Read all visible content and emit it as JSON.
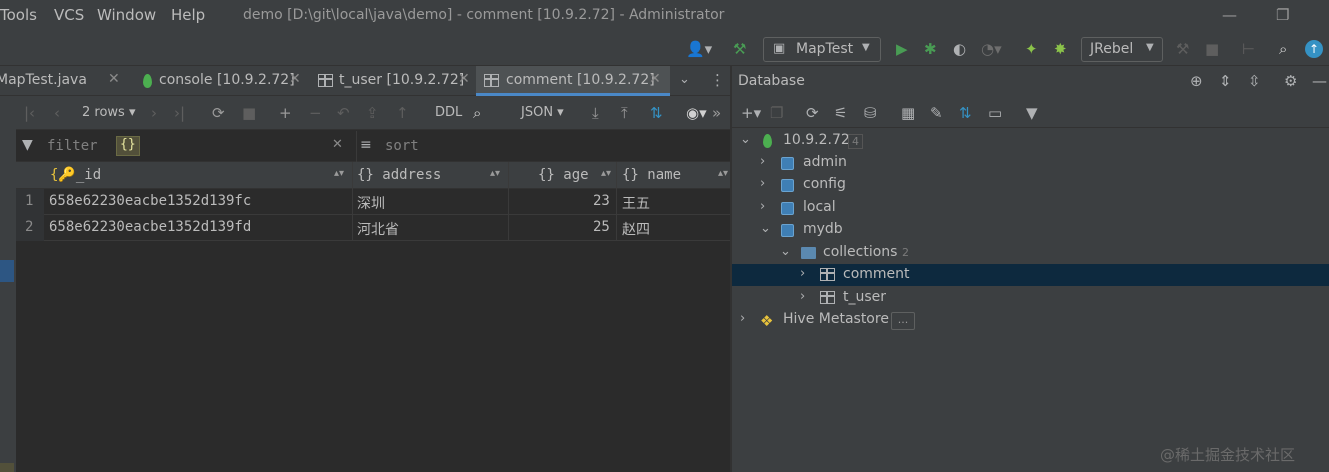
{
  "menubar": {
    "items": [
      "Tools",
      "VCS",
      "Window",
      "Help"
    ],
    "window_title": "demo [D:\\git\\local\\java\\demo] - comment [10.9.2.72] - Administrator"
  },
  "toolbar": {
    "run_config": "MapTest",
    "jrebel": "JRebel"
  },
  "tabs": [
    {
      "label": "MapTest.java",
      "active": false
    },
    {
      "label": "console [10.9.2.72]",
      "active": false
    },
    {
      "label": "t_user [10.9.2.72]",
      "active": false
    },
    {
      "label": "comment [10.9.2.72]",
      "active": true
    }
  ],
  "grid_toolbar": {
    "rows_label": "2 rows",
    "ddl_label": "DDL",
    "format_label": "JSON"
  },
  "filter_bar": {
    "filter_label": "filter",
    "filter_value": "{}",
    "sort_label": "sort"
  },
  "grid": {
    "columns": [
      "_id",
      "address",
      "age",
      "name"
    ],
    "rows": [
      {
        "num": "1",
        "_id": "658e62230eacbe1352d139fc",
        "address": "深圳",
        "age": "23",
        "name": "王五"
      },
      {
        "num": "2",
        "_id": "658e62230eacbe1352d139fd",
        "address": "河北省",
        "age": "25",
        "name": "赵四"
      }
    ]
  },
  "database_panel": {
    "title": "Database",
    "tree": {
      "host": {
        "label": "10.9.2.72",
        "count": "4"
      },
      "databases": [
        "admin",
        "config",
        "local",
        "mydb"
      ],
      "collections_label": "collections",
      "collections_count": "2",
      "collections": [
        "comment",
        "t_user"
      ],
      "hive": {
        "label": "Hive Metastore",
        "button": "..."
      }
    }
  },
  "watermark": "@稀土掘金技术社区",
  "colors": {
    "background": "#2b2b2b",
    "panel": "#3c3f41",
    "selection": "#0d293e",
    "accent": "#4a88c7",
    "run_green": "#499c54"
  }
}
